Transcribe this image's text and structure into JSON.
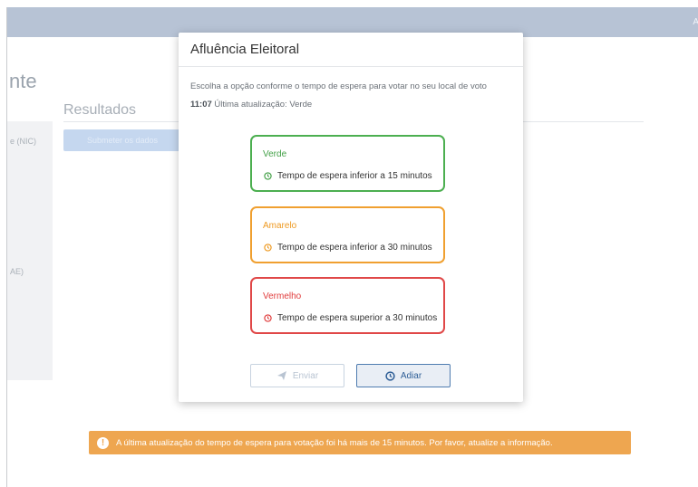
{
  "background": {
    "topbar_right": "A",
    "page_title": "nte",
    "results_heading": "Resultados",
    "left_label_1": "e (NIC)",
    "left_label_2": "AE)",
    "blue_button": "Submeter os dados"
  },
  "modal": {
    "title": "Afluência Eleitoral",
    "instructions": "Escolha a opção conforme o tempo de espera para votar no seu local de voto",
    "update_time": "11:07",
    "update_text": "Última atualização: Verde",
    "options": [
      {
        "name": "Verde",
        "description": "Tempo de espera inferior a 15 minutos",
        "color": "#4caf50",
        "icon": "clock-icon"
      },
      {
        "name": "Amarelo",
        "description": "Tempo de espera inferior a 30 minutos",
        "color": "#f0a030",
        "icon": "clock-icon"
      },
      {
        "name": "Vermelho",
        "description": "Tempo de espera superior a 30 minutos",
        "color": "#e04848",
        "icon": "clock-icon"
      }
    ],
    "send_label": "Enviar",
    "send_icon": "send-icon",
    "defer_label": "Adiar",
    "defer_icon": "clock-icon"
  },
  "alert": {
    "icon": "exclamation-icon",
    "text": "A última atualização do tempo de espera para votação foi há mais de 15 minutos. Por favor, atualize a informação."
  }
}
